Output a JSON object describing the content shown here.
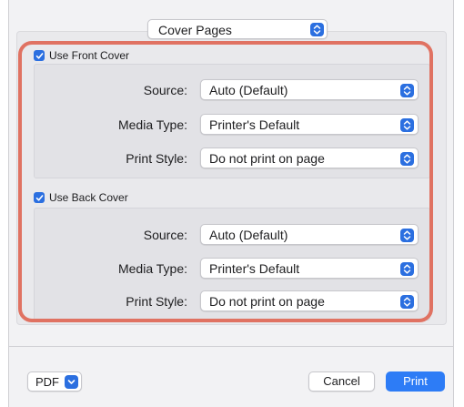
{
  "pane_selector": {
    "value": "Cover Pages"
  },
  "front_cover": {
    "checkbox_label": "Use Front Cover",
    "checked": true,
    "rows": [
      {
        "label": "Source:",
        "value": "Auto (Default)"
      },
      {
        "label": "Media Type:",
        "value": "Printer's Default"
      },
      {
        "label": "Print Style:",
        "value": "Do not print on page"
      }
    ]
  },
  "back_cover": {
    "checkbox_label": "Use Back Cover",
    "checked": true,
    "rows": [
      {
        "label": "Source:",
        "value": "Auto (Default)"
      },
      {
        "label": "Media Type:",
        "value": "Printer's Default"
      },
      {
        "label": "Print Style:",
        "value": "Do not print on page"
      }
    ]
  },
  "footer": {
    "pdf_label": "PDF",
    "cancel_label": "Cancel",
    "print_label": "Print"
  },
  "colors": {
    "accent": "#2b6fe0",
    "print_button": "#2d7cf6",
    "highlight_outline": "#e07262"
  },
  "icons": {
    "stepper": "chevron-up-down-icon",
    "checkbox": "checkmark-icon",
    "pdf_dropdown": "chevron-down-icon"
  }
}
